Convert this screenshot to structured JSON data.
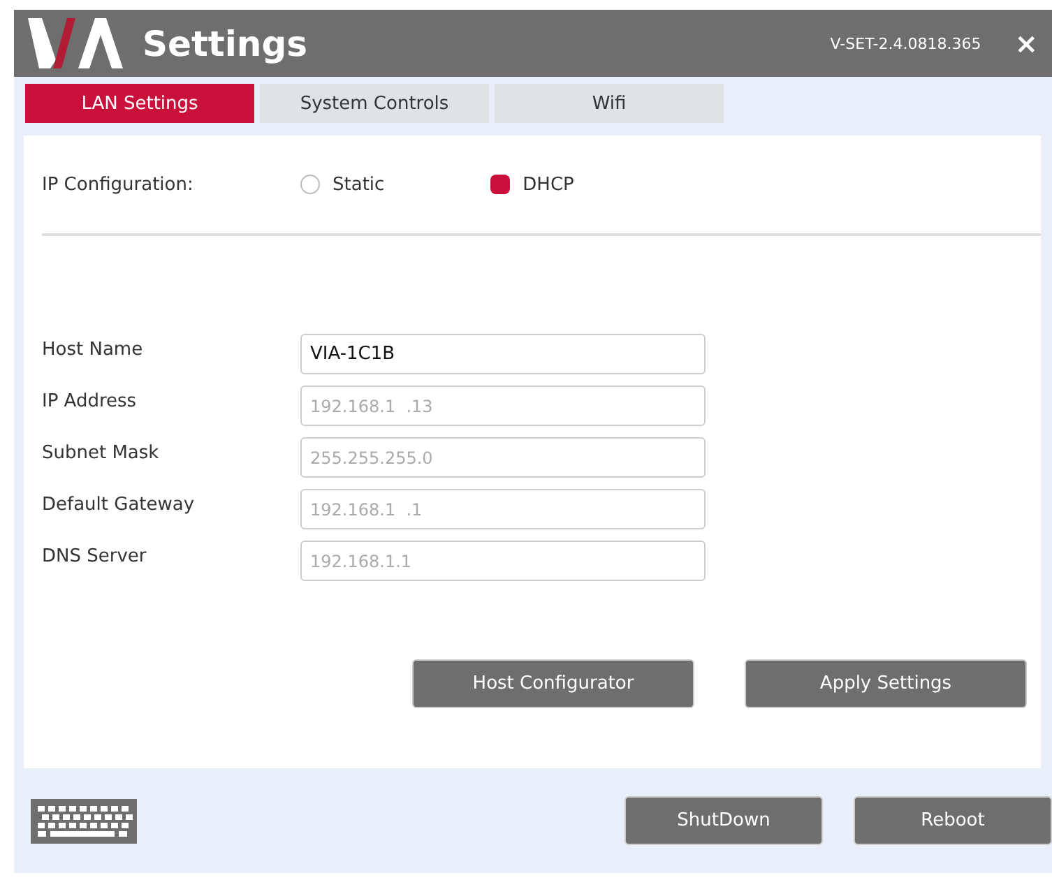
{
  "window": {
    "title": "Settings",
    "version": "V-SET-2.4.0818.365",
    "close": "×"
  },
  "tabs": [
    {
      "label": "LAN Settings",
      "selected": true
    },
    {
      "label": "System Controls",
      "selected": false
    },
    {
      "label": "Wifi",
      "selected": false
    }
  ],
  "ip_configuration": {
    "label": "IP Configuration:",
    "options": [
      {
        "label": "Static",
        "selected": false
      },
      {
        "label": "DHCP",
        "selected": true
      }
    ]
  },
  "fields": [
    {
      "label": "Host Name",
      "value": "VIA-1C1B",
      "disabled": false
    },
    {
      "label": "IP Address",
      "value": "192.168.1  .13",
      "disabled": true
    },
    {
      "label": "Subnet Mask",
      "value": "255.255.255.0",
      "disabled": true
    },
    {
      "label": "Default Gateway",
      "value": "192.168.1  .1",
      "disabled": true
    },
    {
      "label": "DNS Server",
      "value": "192.168.1.1",
      "disabled": true
    }
  ],
  "panel_buttons": [
    "Host Configurator",
    "Apply Settings"
  ],
  "footer_buttons": [
    "ShutDown",
    "Reboot"
  ]
}
